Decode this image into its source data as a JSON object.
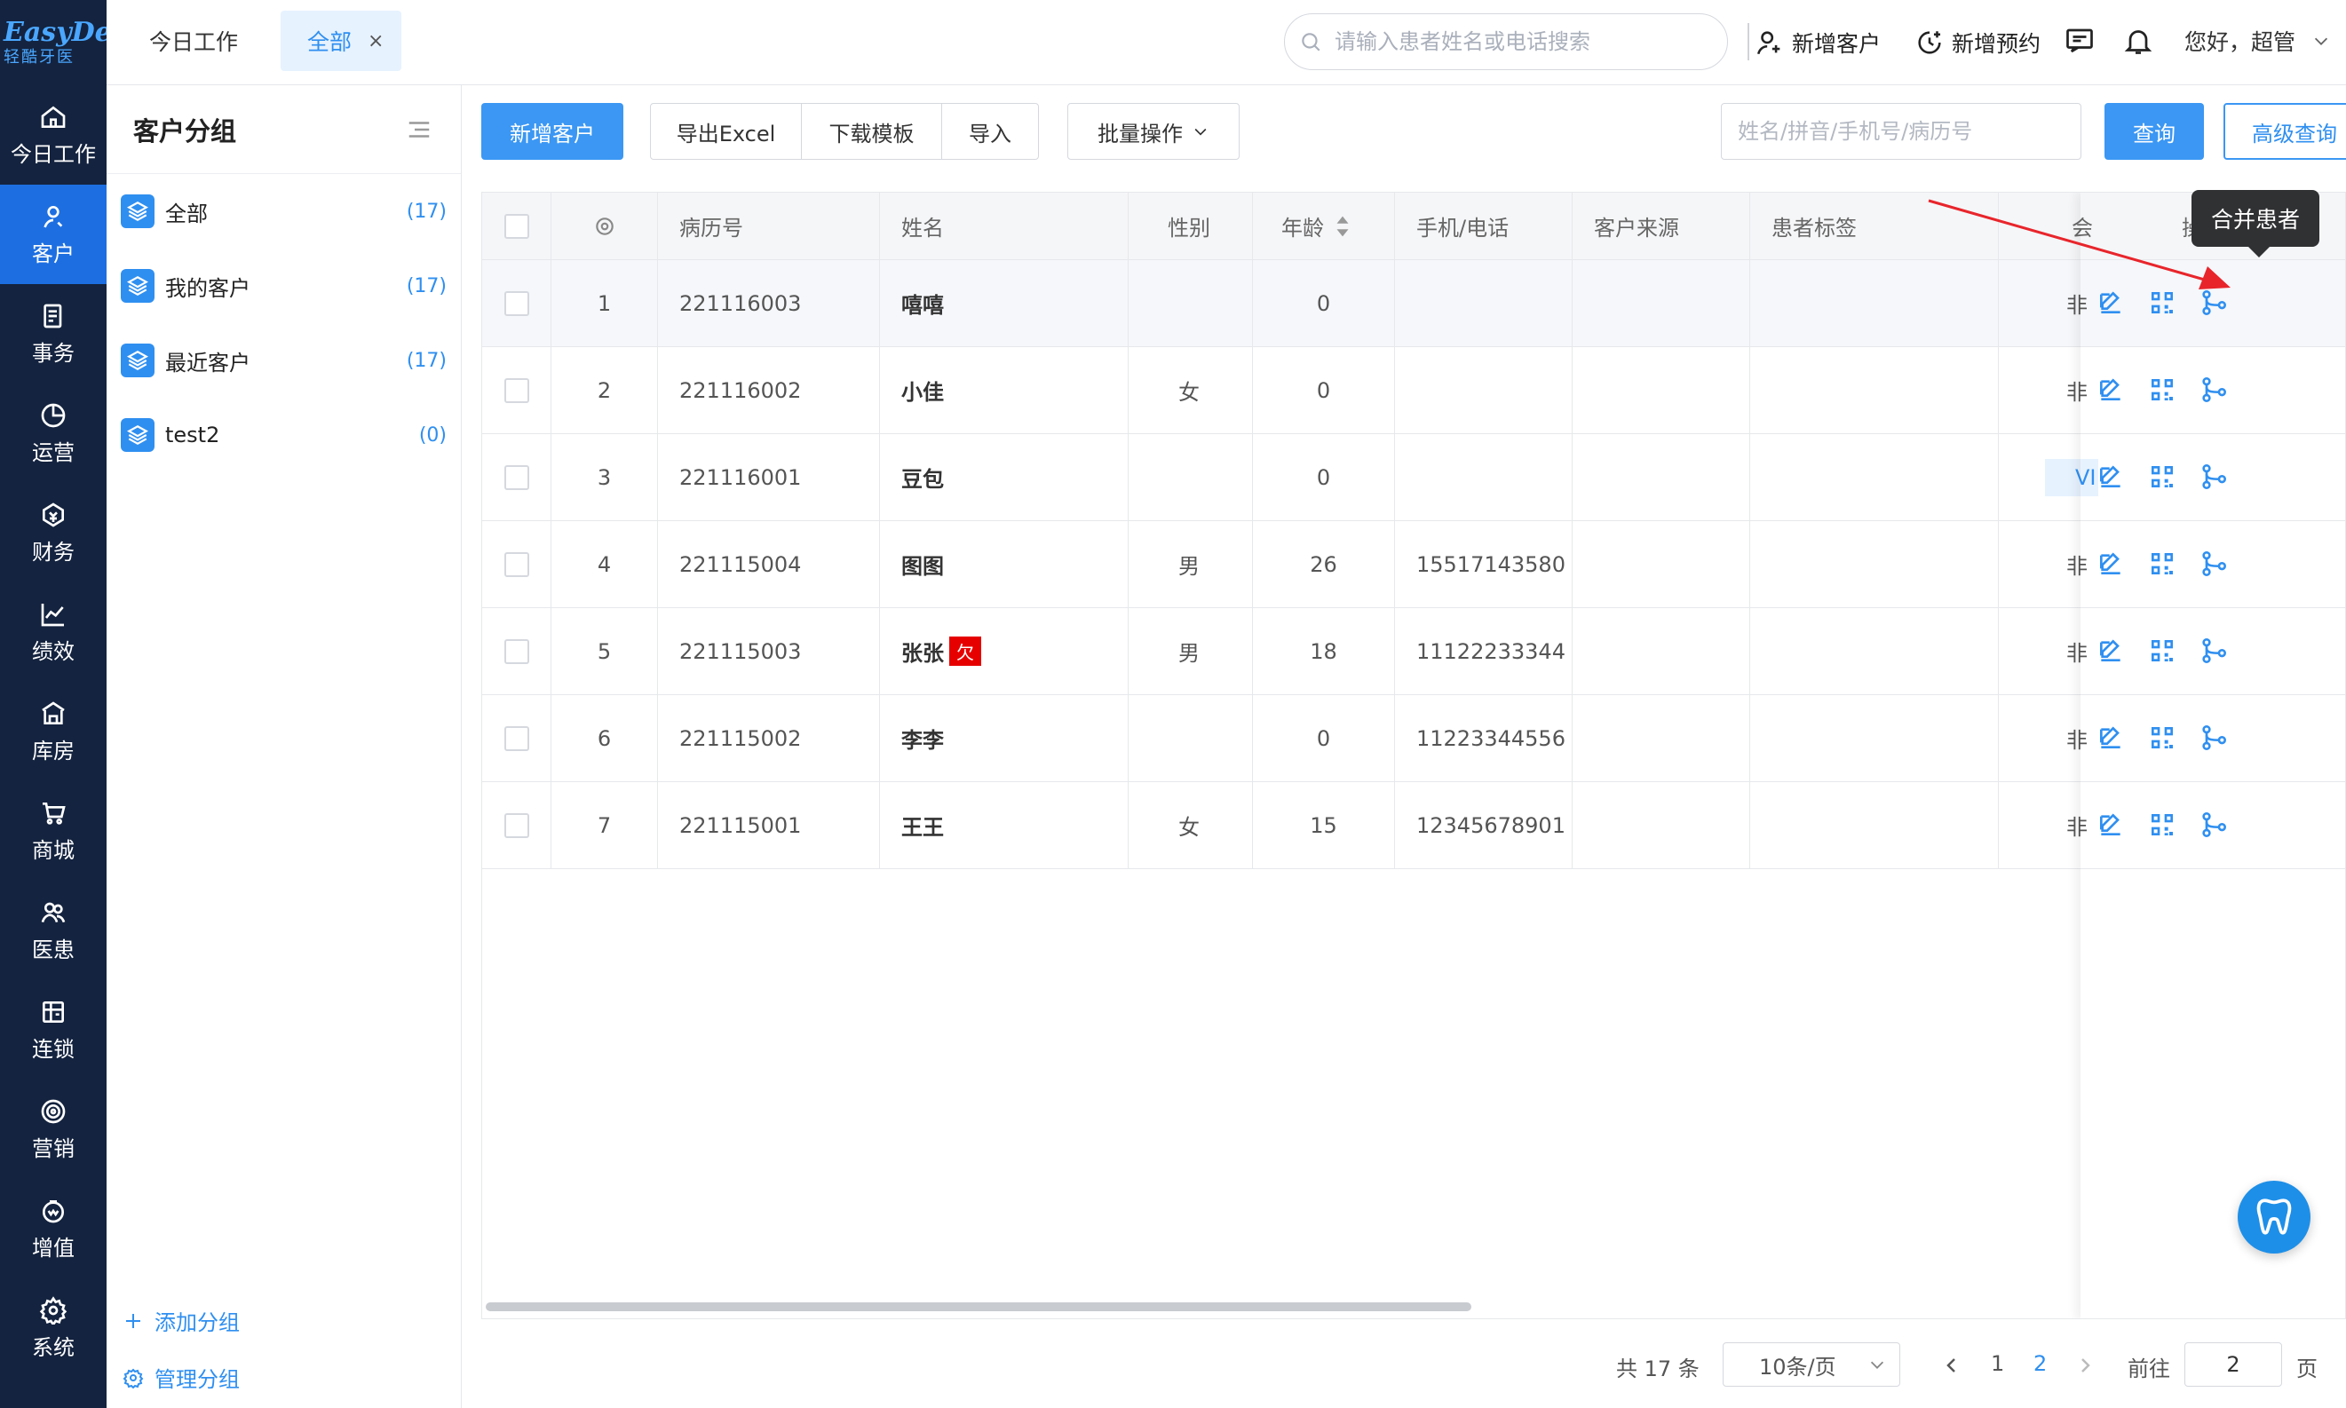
{
  "brand": {
    "name": "EasyDent",
    "subtitle": "轻酷牙医"
  },
  "nav": [
    {
      "label": "今日工作",
      "icon": "home-icon"
    },
    {
      "label": "客户",
      "icon": "user-icon",
      "active": true
    },
    {
      "label": "事务",
      "icon": "task-icon"
    },
    {
      "label": "运营",
      "icon": "pie-icon"
    },
    {
      "label": "财务",
      "icon": "money-icon"
    },
    {
      "label": "绩效",
      "icon": "chart-icon"
    },
    {
      "label": "库房",
      "icon": "warehouse-icon"
    },
    {
      "label": "商城",
      "icon": "cart-icon"
    },
    {
      "label": "医患",
      "icon": "doctor-patient-icon"
    },
    {
      "label": "连锁",
      "icon": "store-icon"
    },
    {
      "label": "营销",
      "icon": "target-icon"
    },
    {
      "label": "增值",
      "icon": "value-icon"
    },
    {
      "label": "系统",
      "icon": "gear-icon"
    }
  ],
  "topbar": {
    "tabs": [
      {
        "label": "今日工作"
      },
      {
        "label": "全部",
        "close": "×"
      }
    ],
    "search_placeholder": "请输入患者姓名或电话搜索",
    "add_customer": "新增客户",
    "add_appointment": "新增预约",
    "greeting": "您好，超管"
  },
  "groups": {
    "title": "客户分组",
    "items": [
      {
        "name": "全部",
        "count": "(17)"
      },
      {
        "name": "我的客户",
        "count": "(17)"
      },
      {
        "name": "最近客户",
        "count": "(17)"
      },
      {
        "name": "test2",
        "count": "(0)"
      }
    ],
    "add_group": "添加分组",
    "manage_group": "管理分组"
  },
  "toolbar": {
    "add_customer": "新增客户",
    "export_excel": "导出Excel",
    "download_template": "下载模板",
    "import": "导入",
    "batch": "批量操作",
    "search_placeholder": "姓名/拼音/手机号/病历号",
    "query": "查询",
    "advanced_query": "高级查询"
  },
  "table": {
    "headers": {
      "record_no": "病历号",
      "name": "姓名",
      "gender": "性别",
      "age": "年龄",
      "phone": "手机/电话",
      "source": "客户来源",
      "tags": "患者标签",
      "member": "会",
      "ops": "操"
    },
    "rows": [
      {
        "no": "1",
        "record": "221116003",
        "name": "嘻嘻",
        "gender": "",
        "age": "0",
        "phone": "",
        "member": "非"
      },
      {
        "no": "2",
        "record": "221116002",
        "name": "小佳",
        "gender": "女",
        "age": "0",
        "phone": "",
        "member": "非"
      },
      {
        "no": "3",
        "record": "221116001",
        "name": "豆包",
        "gender": "",
        "age": "0",
        "phone": "",
        "member": "VI"
      },
      {
        "no": "4",
        "record": "221115004",
        "name": "图图",
        "gender": "男",
        "age": "26",
        "phone": "15517143580",
        "member": "非"
      },
      {
        "no": "5",
        "record": "221115003",
        "name": "张张",
        "gender": "男",
        "age": "18",
        "phone": "11122233344",
        "member": "非",
        "badge": "欠"
      },
      {
        "no": "6",
        "record": "221115002",
        "name": "李李",
        "gender": "",
        "age": "0",
        "phone": "11223344556",
        "member": "非"
      },
      {
        "no": "7",
        "record": "221115001",
        "name": "王王",
        "gender": "女",
        "age": "15",
        "phone": "12345678901",
        "member": "非"
      }
    ],
    "tooltip": "合并患者"
  },
  "pager": {
    "total": "共 17 条",
    "size": "10条/页",
    "pages": [
      "1",
      "2"
    ],
    "current": "2",
    "goto": "前往",
    "goto_value": "2",
    "page_unit": "页"
  },
  "colors": {
    "primary": "#3b97f3",
    "nav_bg": "#14233f",
    "nav_active": "#1d6fe1",
    "badge_red": "#e60000",
    "arrow_red": "#e8252b"
  }
}
